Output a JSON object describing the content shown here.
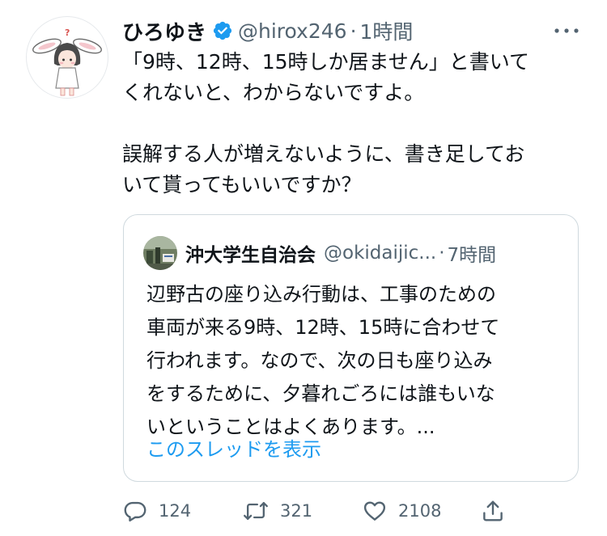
{
  "tweet": {
    "display_name": "ひろゆき",
    "handle": "@hirox246",
    "separator": "·",
    "time": "1時間",
    "lines": [
      "「9時、12時、15時しか居ません」と書いて",
      "くれないと、わからないですよ。",
      "",
      "誤解する人が増えないように、書き足してお",
      "いて貰ってもいいですか？"
    ]
  },
  "quote": {
    "display_name": "沖大学生自治会",
    "handle": "@okidaijic...",
    "separator": "·",
    "time": "7時間",
    "lines": [
      "辺野古の座り込み行動は、工事のための",
      "車両が来る9時、12時、15時に合わせて",
      "行われます。なので、次の日も座り込み",
      "をするために、夕暮れごろには誰もいな",
      "いということはよくあります。..."
    ],
    "show_thread": "このスレッドを表示"
  },
  "actions": {
    "reply_count": "124",
    "retweet_count": "321",
    "like_count": "2108"
  },
  "icons": {
    "verified": "verified-badge-icon",
    "more": "more-options-icon",
    "reply": "reply-icon",
    "retweet": "retweet-icon",
    "like": "like-icon",
    "share": "share-icon"
  },
  "colors": {
    "accent": "#1d9bf0",
    "text": "#0f1419",
    "secondary": "#536471",
    "border": "#cfd9de"
  }
}
